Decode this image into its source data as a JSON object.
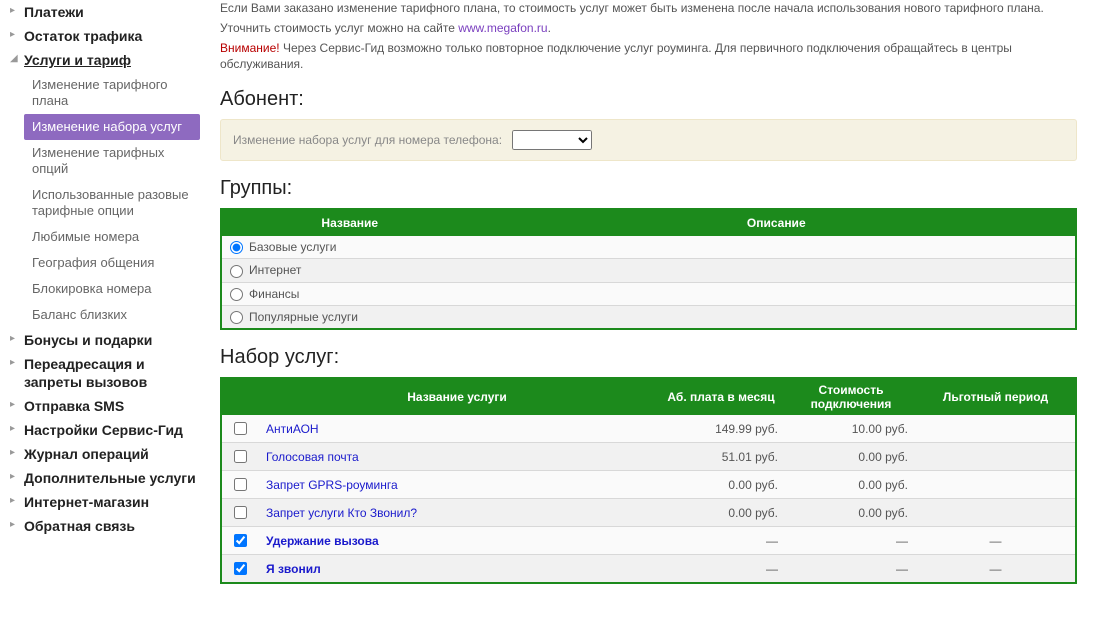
{
  "info": {
    "line1": "Если Вами заказано изменение тарифного плана, то стоимость услуг может быть изменена после начала использования нового тарифного плана.",
    "line2_prefix": "Уточнить стоимость услуг можно на сайте ",
    "line2_link": "www.megafon.ru",
    "line2_suffix": ".",
    "warn_label": "Внимание!",
    "warn_text": " Через Сервис-Гид возможно только повторное подключение услуг роуминга. Для первичного подключения обращайтесь в центры обслуживания."
  },
  "sidebar": {
    "items": [
      {
        "label": "Платежи",
        "open": false,
        "sub": []
      },
      {
        "label": "Остаток трафика",
        "open": false,
        "sub": []
      },
      {
        "label": "Услуги и тариф",
        "open": true,
        "sub": [
          "Изменение тарифного плана",
          "Изменение набора услуг",
          "Изменение тарифных опций",
          "Использованные разовые тарифные опции",
          "Любимые номера",
          "География общения",
          "Блокировка номера",
          "Баланс близких"
        ],
        "active_sub": 1
      },
      {
        "label": "Бонусы и подарки",
        "open": false,
        "sub": []
      },
      {
        "label": "Переадресация и запреты вызовов",
        "open": false,
        "sub": []
      },
      {
        "label": "Отправка SMS",
        "open": false,
        "sub": []
      },
      {
        "label": "Настройки Сервис-Гид",
        "open": false,
        "sub": []
      },
      {
        "label": "Журнал операций",
        "open": false,
        "sub": []
      },
      {
        "label": "Дополнительные услуги",
        "open": false,
        "sub": []
      },
      {
        "label": "Интернет-магазин",
        "open": false,
        "sub": []
      },
      {
        "label": "Обратная связь",
        "open": false,
        "sub": []
      }
    ]
  },
  "section_subscriber": "Абонент:",
  "phone_bar": {
    "label": "Изменение набора услуг для номера телефона:",
    "selected": ""
  },
  "section_groups": "Группы:",
  "groups_table": {
    "headers": [
      "Название",
      "Описание"
    ],
    "rows": [
      {
        "name": "Базовые услуги",
        "selected": true
      },
      {
        "name": "Интернет",
        "selected": false
      },
      {
        "name": "Финансы",
        "selected": false
      },
      {
        "name": "Популярные услуги",
        "selected": false
      }
    ]
  },
  "section_services": "Набор услуг:",
  "services_table": {
    "headers": [
      "Название услуги",
      "Аб. плата в месяц",
      "Стоимость подключения",
      "Льготный период"
    ],
    "rows": [
      {
        "checked": false,
        "name": "АнтиАОН",
        "fee": "149.99 руб.",
        "cost": "10.00 руб.",
        "period": ""
      },
      {
        "checked": false,
        "name": "Голосовая почта",
        "fee": "51.01 руб.",
        "cost": "0.00 руб.",
        "period": ""
      },
      {
        "checked": false,
        "name": "Запрет GPRS-роуминга",
        "fee": "0.00 руб.",
        "cost": "0.00 руб.",
        "period": ""
      },
      {
        "checked": false,
        "name": "Запрет услуги Кто Звонил?",
        "fee": "0.00 руб.",
        "cost": "0.00 руб.",
        "period": ""
      },
      {
        "checked": true,
        "name": "Удержание вызова",
        "fee": "—",
        "cost": "—",
        "period": "—"
      },
      {
        "checked": true,
        "name": "Я звонил",
        "fee": "—",
        "cost": "—",
        "period": "—"
      }
    ]
  }
}
